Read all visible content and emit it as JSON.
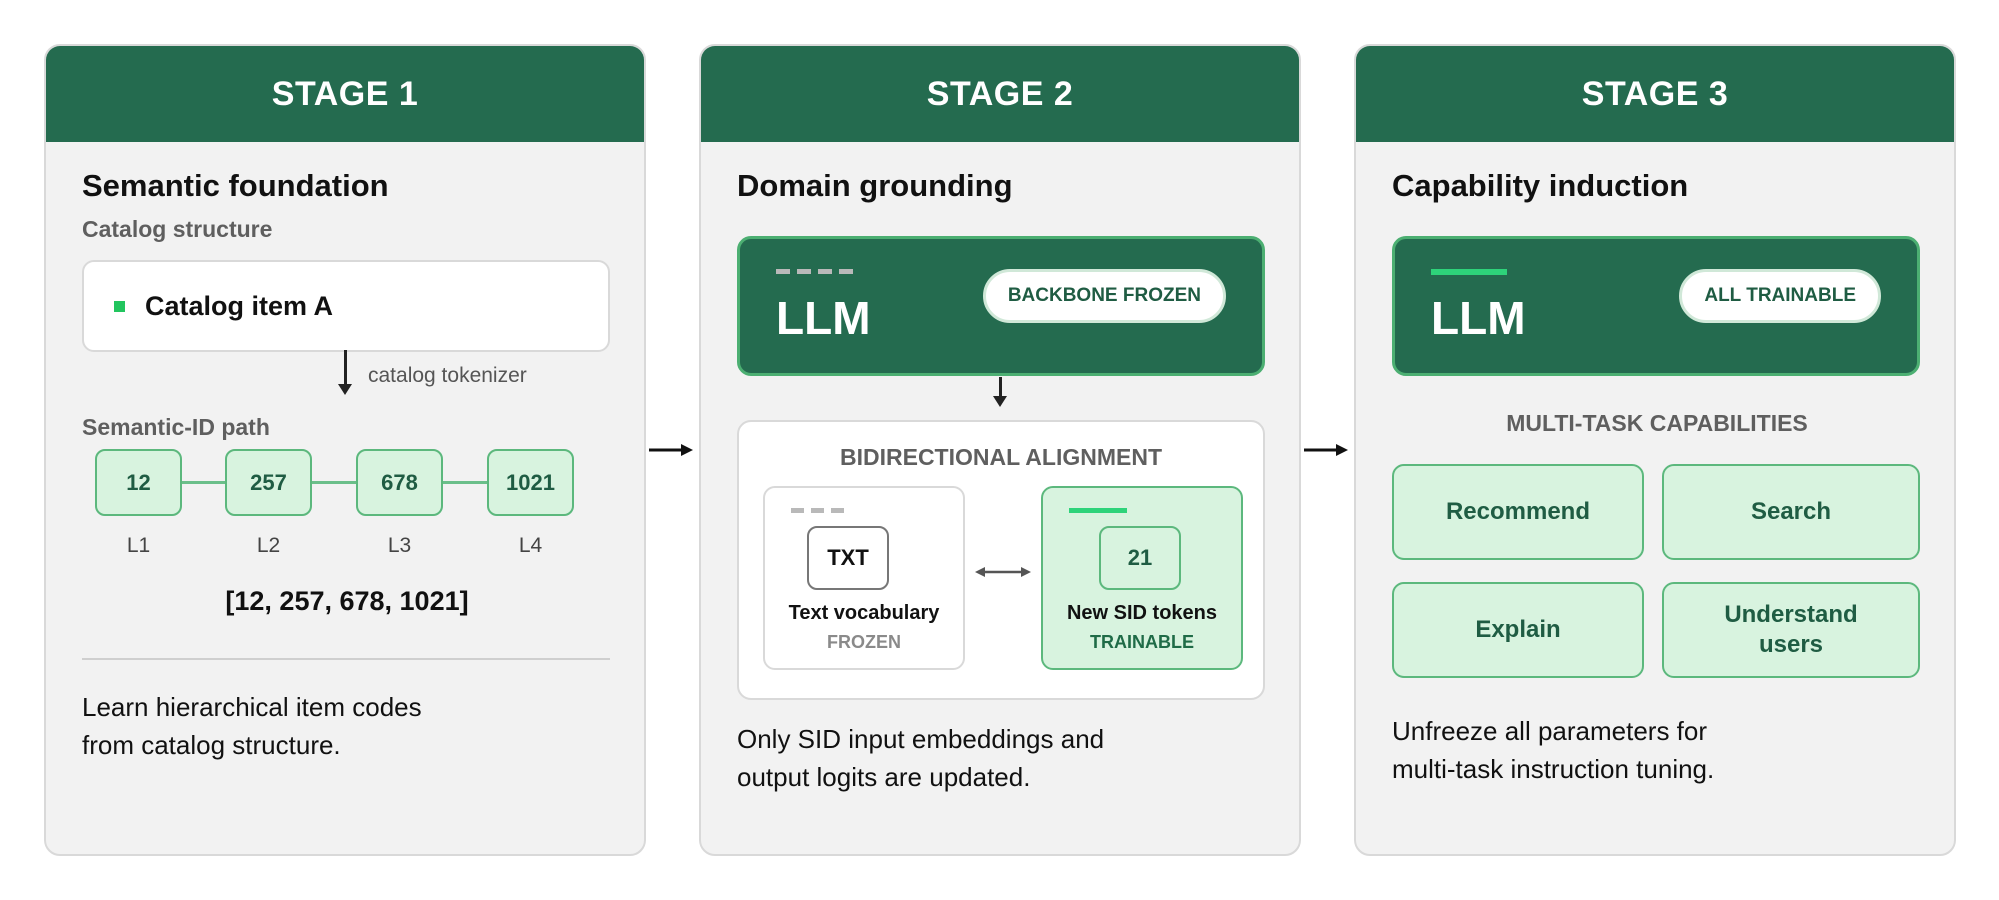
{
  "stages": [
    {
      "header": "STAGE 1",
      "title": "Semantic foundation",
      "subtitle": "Catalog structure",
      "catalog_item": "Catalog item A",
      "tokenizer_label": "catalog tokenizer",
      "sid_path_label": "Semantic-ID path",
      "sid_nodes": [
        {
          "code": "12",
          "level": "L1"
        },
        {
          "code": "257",
          "level": "L2"
        },
        {
          "code": "678",
          "level": "L3"
        },
        {
          "code": "1021",
          "level": "L4"
        }
      ],
      "sid_array": "[12, 257, 678, 1021]",
      "description_lines": [
        "Learn hierarchical item codes",
        "from catalog structure."
      ]
    },
    {
      "header": "STAGE 2",
      "title": "Domain grounding",
      "llm_label": "LLM",
      "llm_badge": "BACKBONE FROZEN",
      "alignment_title": "BIDIRECTIONAL ALIGNMENT",
      "text_vocab": {
        "chip": "TXT",
        "name": "Text vocabulary",
        "state": "FROZEN"
      },
      "sid_tokens": {
        "chip": "21",
        "name": "New SID tokens",
        "state": "TRAINABLE"
      },
      "description_lines": [
        "Only SID input embeddings and",
        "output logits are updated."
      ]
    },
    {
      "header": "STAGE 3",
      "title": "Capability induction",
      "llm_label": "LLM",
      "llm_badge": "ALL TRAINABLE",
      "capabilities_title": "MULTI-TASK CAPABILITIES",
      "capabilities": [
        "Recommend",
        "Search",
        "Explain",
        "Understand users"
      ],
      "description_lines": [
        "Unfreeze all parameters for",
        "multi-task instruction tuning."
      ]
    }
  ],
  "colors": {
    "header_green": "#246b4f",
    "accent_green": "#22c55e",
    "chip_fill": "#d8f3df",
    "chip_border": "#5cb87d",
    "panel_bg": "#f2f2f2"
  },
  "icons": [
    "arrow-right-icon",
    "arrow-down-icon",
    "double-arrow-icon"
  ]
}
